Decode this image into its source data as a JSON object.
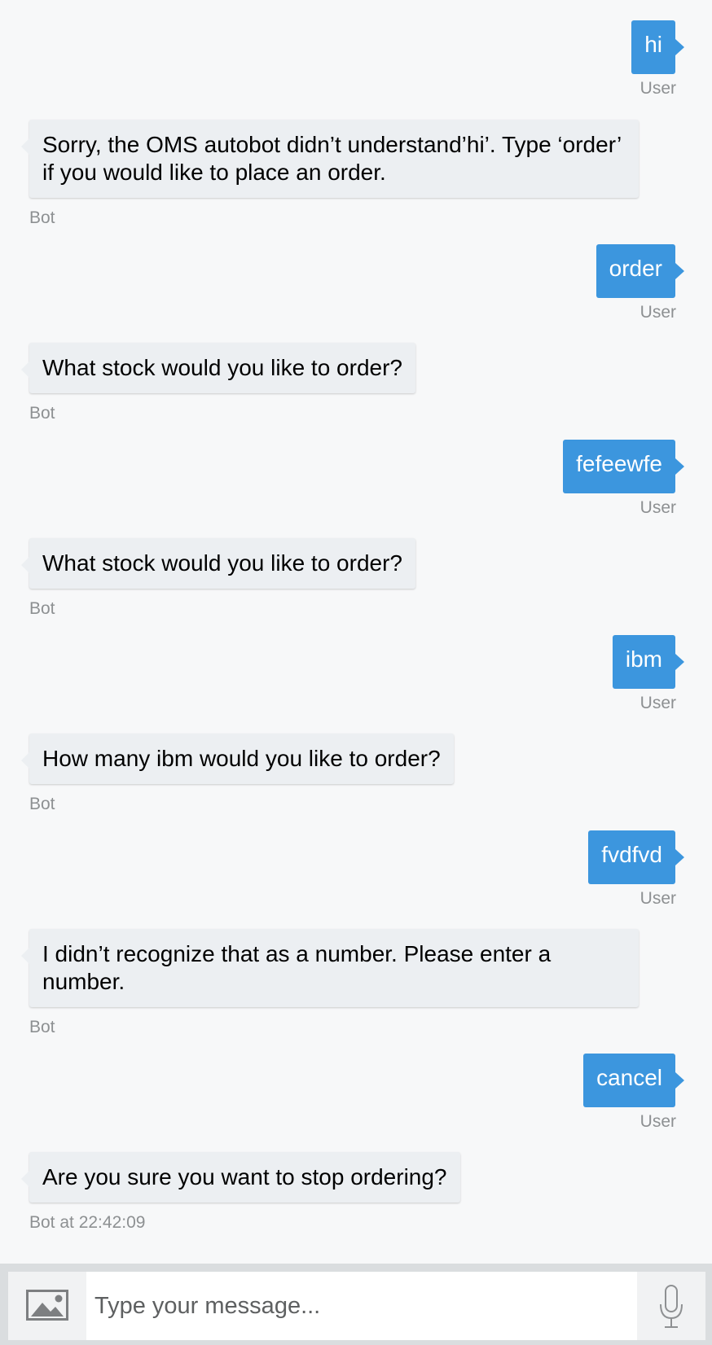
{
  "messages": [
    {
      "from": "user",
      "text": "hi",
      "sender": "User"
    },
    {
      "from": "bot",
      "text": "Sorry, the OMS autobot didn’t understand’hi’. Type ‘order’ if you would like to place an order.",
      "sender": "Bot"
    },
    {
      "from": "user",
      "text": "order",
      "sender": "User"
    },
    {
      "from": "bot",
      "text": "What stock would you like to order?",
      "sender": "Bot"
    },
    {
      "from": "user",
      "text": "fefeewfe",
      "sender": "User"
    },
    {
      "from": "bot",
      "text": "What stock would you like to order?",
      "sender": "Bot"
    },
    {
      "from": "user",
      "text": "ibm",
      "sender": "User"
    },
    {
      "from": "bot",
      "text": "How many ibm would you like to order?",
      "sender": "Bot"
    },
    {
      "from": "user",
      "text": "fvdfvd",
      "sender": "User"
    },
    {
      "from": "bot",
      "text": "I didn’t recognize that as a number. Please enter a number.",
      "sender": "Bot"
    },
    {
      "from": "user",
      "text": "cancel",
      "sender": "User"
    },
    {
      "from": "bot",
      "text": "Are you sure you want to stop ordering?",
      "sender": "Bot at 22:42:09"
    }
  ],
  "composer": {
    "placeholder": "Type your message...",
    "image_icon": "image-icon",
    "mic_icon": "microphone-icon"
  },
  "colors": {
    "user_bubble": "#3c96de",
    "bot_bubble": "#eceff2",
    "background": "#f7f8f9",
    "sender_text": "#8d9092"
  }
}
